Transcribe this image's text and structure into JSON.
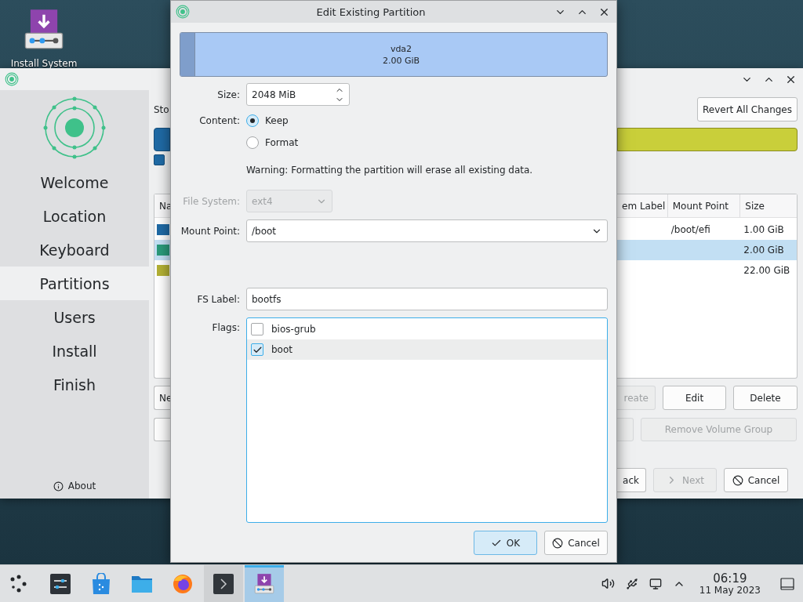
{
  "desktop": {
    "icons": [
      {
        "label": "Install System"
      }
    ]
  },
  "installer": {
    "sidebar": {
      "items": [
        {
          "label": "Welcome",
          "selected": false
        },
        {
          "label": "Location",
          "selected": false
        },
        {
          "label": "Keyboard",
          "selected": false
        },
        {
          "label": "Partitions",
          "selected": true
        },
        {
          "label": "Users",
          "selected": false
        },
        {
          "label": "Install",
          "selected": false
        },
        {
          "label": "Finish",
          "selected": false
        }
      ],
      "about": "About"
    },
    "heading": "Sto",
    "revert_button": "Revert All Changes",
    "table": {
      "columns": [
        "Na",
        "em Label",
        "Mount Point",
        "Size"
      ],
      "rows": [
        {
          "color": "#1f6aa5",
          "mount_point": "/boot/efi",
          "size": "1.00 GiB",
          "selected": false
        },
        {
          "color": "#2a9a7a",
          "size": "2.00 GiB",
          "selected": true
        },
        {
          "color": "#b3b034",
          "size": "22.00 GiB",
          "selected": false
        }
      ]
    },
    "action_buttons": [
      {
        "label": "reate",
        "disabled": true
      },
      {
        "label": "Edit",
        "disabled": false
      },
      {
        "label": "Delete",
        "disabled": false
      }
    ],
    "left_buttons": [
      {
        "label": "Ne",
        "disabled": false
      },
      {
        "disabled": false
      }
    ],
    "volume_buttons": [
      {
        "disabled": true
      },
      {
        "label": "Remove Volume Group",
        "disabled": true
      }
    ],
    "nav_buttons": [
      {
        "kind": "back",
        "label": "ack",
        "disabled": false
      },
      {
        "kind": "next",
        "label": "Next",
        "disabled": true
      },
      {
        "kind": "cancel",
        "label": "Cancel",
        "disabled": false
      }
    ]
  },
  "dialog": {
    "title": "Edit Existing Partition",
    "partition_bar": {
      "name": "vda2",
      "size": "2.00 GiB"
    },
    "size": {
      "label": "Size:",
      "value": "2048 MiB"
    },
    "content": {
      "label": "Content:",
      "options": [
        {
          "label": "Keep",
          "selected": true
        },
        {
          "label": "Format",
          "selected": false
        }
      ]
    },
    "warning": "Warning: Formatting the partition will erase all existing data.",
    "file_system": {
      "label": "File System:",
      "value": "ext4",
      "disabled": true
    },
    "mount_point": {
      "label": "Mount Point:",
      "value": "/boot"
    },
    "fs_label": {
      "label": "FS Label:",
      "value": "bootfs"
    },
    "flags": {
      "label": "Flags:",
      "items": [
        {
          "label": "bios-grub",
          "checked": false,
          "highlighted": false
        },
        {
          "label": "boot",
          "checked": true,
          "highlighted": true
        }
      ]
    },
    "buttons": [
      {
        "kind": "ok",
        "label": "OK",
        "default": true
      },
      {
        "kind": "cancel",
        "label": "Cancel",
        "default": false
      }
    ]
  },
  "taskbar": {
    "tasks": [
      {
        "kind": "launcher",
        "open": false,
        "selected": false
      },
      {
        "kind": "settings",
        "open": false,
        "selected": false
      },
      {
        "kind": "store",
        "open": false,
        "selected": false
      },
      {
        "kind": "files",
        "open": false,
        "selected": false
      },
      {
        "kind": "browser",
        "open": false,
        "selected": false
      },
      {
        "kind": "terminal",
        "open": true,
        "selected": false
      },
      {
        "kind": "installer",
        "open": true,
        "selected": true
      }
    ],
    "tray": [
      {
        "kind": "volume"
      },
      {
        "kind": "usb"
      },
      {
        "kind": "network"
      },
      {
        "kind": "expand"
      }
    ],
    "clock": {
      "time": "06:19",
      "date": "11 May 2023"
    }
  }
}
